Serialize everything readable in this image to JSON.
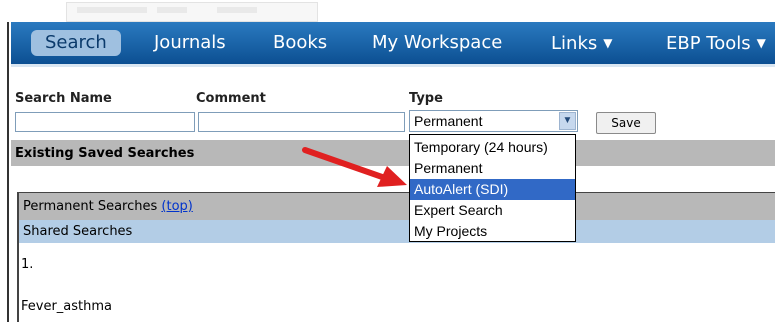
{
  "nav": {
    "items": [
      {
        "label": "Search",
        "active": true
      },
      {
        "label": "Journals"
      },
      {
        "label": "Books"
      },
      {
        "label": "My Workspace"
      },
      {
        "label": "Links",
        "caret": "▼"
      },
      {
        "label": "EBP Tools",
        "caret": "▼"
      }
    ]
  },
  "form": {
    "search_name_label": "Search Name",
    "comment_label": "Comment",
    "type_label": "Type",
    "search_name_value": "",
    "comment_value": "",
    "type_selected": "Permanent",
    "save_label": "Save"
  },
  "dropdown": {
    "options": [
      "Temporary (24 hours)",
      "Permanent",
      "AutoAlert (SDI)",
      "Expert Search",
      "My Projects"
    ],
    "highlighted": "AutoAlert (SDI)"
  },
  "sections": {
    "existing_saved": "Existing Saved Searches",
    "permanent_searches": "Permanent Searches",
    "top_link": "(top)",
    "shared_searches": "Shared Searches",
    "item_number": "1.",
    "item_name": "Fever_asthma"
  },
  "colors": {
    "nav_bg": "#1565ad",
    "section_gray": "#b8b8b8",
    "section_blue": "#b3cde6",
    "highlight": "#3169c6",
    "annotation_arrow": "#e02020"
  }
}
